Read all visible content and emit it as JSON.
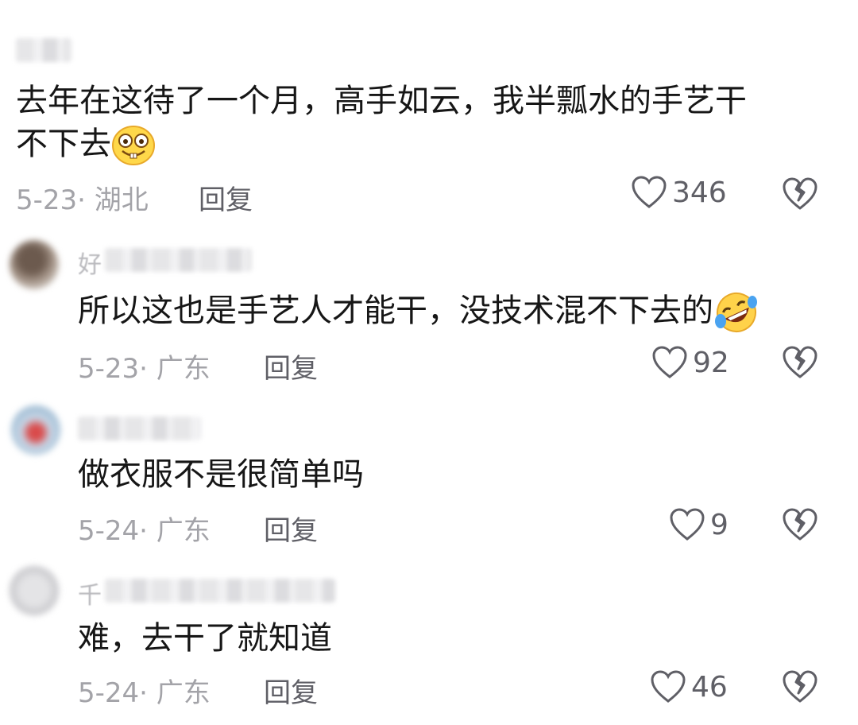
{
  "comments": [
    {
      "name_first": "",
      "text_lines": [
        "去年在这待了一个月，高手如云，我半瓢水的手艺干",
        "不下去"
      ],
      "emoji": "grinning-buck-teeth-emoji",
      "date": "5-23",
      "location": "湖北",
      "reply_label": "回复",
      "likes": "346"
    },
    {
      "name_first": "好",
      "text_lines": [
        "所以这也是手艺人才能干，没技术混不下去的"
      ],
      "emoji": "rolling-laughing-emoji",
      "date": "5-23",
      "location": "广东",
      "reply_label": "回复",
      "likes": "92"
    },
    {
      "name_first": "",
      "text_lines": [
        "做衣服不是很简单吗"
      ],
      "date": "5-24",
      "location": "广东",
      "reply_label": "回复",
      "likes": "9"
    },
    {
      "name_first": "千",
      "text_lines": [
        "难，去干了就知道"
      ],
      "date": "5-24",
      "location": "广东",
      "reply_label": "回复",
      "likes": "46"
    }
  ],
  "icons": {
    "like": "heart-outline-icon",
    "dislike": "broken-heart-icon"
  },
  "colors": {
    "text": "#161616",
    "meta": "#a3a3a8",
    "action": "#5f5f66"
  }
}
